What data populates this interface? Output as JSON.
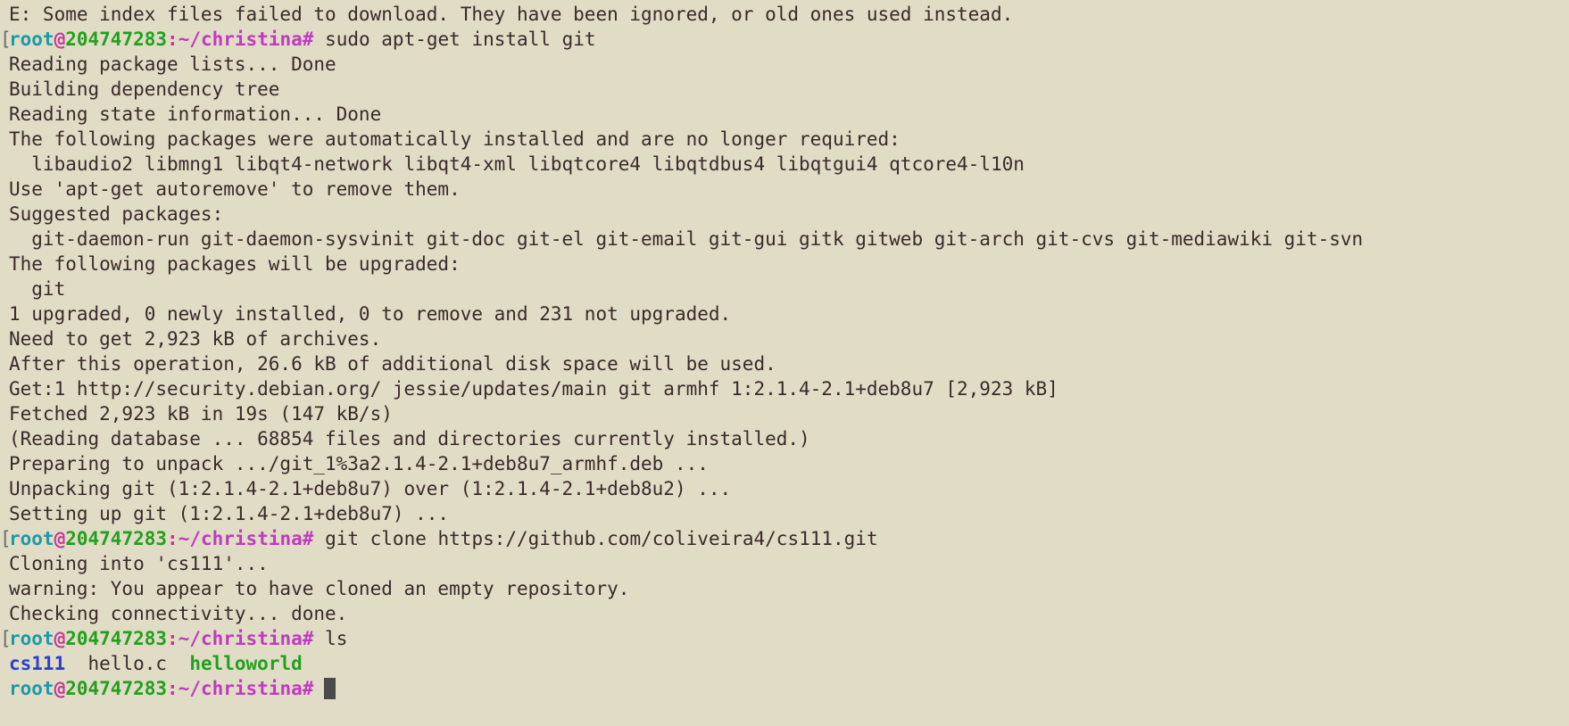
{
  "colors": {
    "background": "#e1dcc6",
    "text": "#3a2a2a",
    "prompt_user": "#1d9aa8",
    "prompt_host": "#23a01d",
    "prompt_path": "#c03ac0",
    "dir": "#2b3fd1",
    "exec": "#23a01d",
    "cursor": "#4a4a4a"
  },
  "prompt": {
    "user": "root",
    "at": "@",
    "host": "204747283",
    "colon": ":",
    "path": "~/christina",
    "symbol": "#"
  },
  "lines": [
    {
      "type": "out",
      "text": "E: Some index files failed to download. They have been ignored, or old ones used instead."
    },
    {
      "type": "prompt",
      "bracket": true,
      "cmd": "sudo apt-get install git"
    },
    {
      "type": "out",
      "text": "Reading package lists... Done"
    },
    {
      "type": "out",
      "text": "Building dependency tree"
    },
    {
      "type": "out",
      "text": "Reading state information... Done"
    },
    {
      "type": "out",
      "text": "The following packages were automatically installed and are no longer required:"
    },
    {
      "type": "out",
      "text": "  libaudio2 libmng1 libqt4-network libqt4-xml libqtcore4 libqtdbus4 libqtgui4 qtcore4-l10n"
    },
    {
      "type": "out",
      "text": "Use 'apt-get autoremove' to remove them."
    },
    {
      "type": "out",
      "text": "Suggested packages:"
    },
    {
      "type": "out",
      "text": "  git-daemon-run git-daemon-sysvinit git-doc git-el git-email git-gui gitk gitweb git-arch git-cvs git-mediawiki git-svn"
    },
    {
      "type": "out",
      "text": "The following packages will be upgraded:"
    },
    {
      "type": "out",
      "text": "  git"
    },
    {
      "type": "out",
      "text": "1 upgraded, 0 newly installed, 0 to remove and 231 not upgraded."
    },
    {
      "type": "out",
      "text": "Need to get 2,923 kB of archives."
    },
    {
      "type": "out",
      "text": "After this operation, 26.6 kB of additional disk space will be used."
    },
    {
      "type": "out",
      "text": "Get:1 http://security.debian.org/ jessie/updates/main git armhf 1:2.1.4-2.1+deb8u7 [2,923 kB]"
    },
    {
      "type": "out",
      "text": "Fetched 2,923 kB in 19s (147 kB/s)"
    },
    {
      "type": "out",
      "text": "(Reading database ... 68854 files and directories currently installed.)"
    },
    {
      "type": "out",
      "text": "Preparing to unpack .../git_1%3a2.1.4-2.1+deb8u7_armhf.deb ..."
    },
    {
      "type": "out",
      "text": "Unpacking git (1:2.1.4-2.1+deb8u7) over (1:2.1.4-2.1+deb8u2) ..."
    },
    {
      "type": "out",
      "text": "Setting up git (1:2.1.4-2.1+deb8u7) ..."
    },
    {
      "type": "prompt",
      "bracket": true,
      "cmd": "git clone https://github.com/coliveira4/cs111.git"
    },
    {
      "type": "out",
      "text": "Cloning into 'cs111'..."
    },
    {
      "type": "out",
      "text": "warning: You appear to have cloned an empty repository."
    },
    {
      "type": "out",
      "text": "Checking connectivity... done."
    },
    {
      "type": "prompt",
      "bracket": true,
      "cmd": "ls"
    },
    {
      "type": "ls",
      "items": [
        {
          "name": "cs111",
          "kind": "dir"
        },
        {
          "name": "hello.c",
          "kind": "file"
        },
        {
          "name": "helloworld",
          "kind": "exec"
        }
      ]
    },
    {
      "type": "prompt",
      "bracket": false,
      "cmd": "",
      "cursor": true
    }
  ]
}
